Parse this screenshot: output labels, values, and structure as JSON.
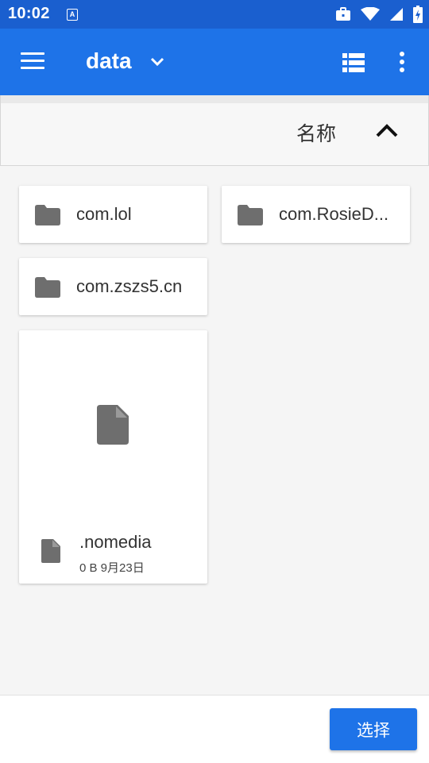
{
  "status_bar": {
    "time": "10:02",
    "notification_badge": "A",
    "icons": [
      "briefcase-icon",
      "wifi-icon",
      "signal-icon",
      "battery-charging-icon"
    ]
  },
  "toolbar": {
    "title": "data",
    "menu_icon": "hamburger-menu-icon",
    "dropdown_icon": "chevron-down-icon",
    "view_toggle_icon": "list-view-icon",
    "more_icon": "more-vert-icon",
    "color": "#1e73e8"
  },
  "sort": {
    "label": "名称",
    "direction_icon": "chevron-up-icon"
  },
  "items": {
    "folders": [
      {
        "name": "com.lol",
        "icon": "folder-icon"
      },
      {
        "name": "com.RosieD...",
        "icon": "folder-icon"
      },
      {
        "name": "com.zszs5.cn",
        "icon": "folder-icon"
      }
    ],
    "files": [
      {
        "name": ".nomedia",
        "meta": "0 B 9月23日",
        "icon": "file-icon"
      }
    ]
  },
  "bottom_bar": {
    "select_label": "选择"
  }
}
